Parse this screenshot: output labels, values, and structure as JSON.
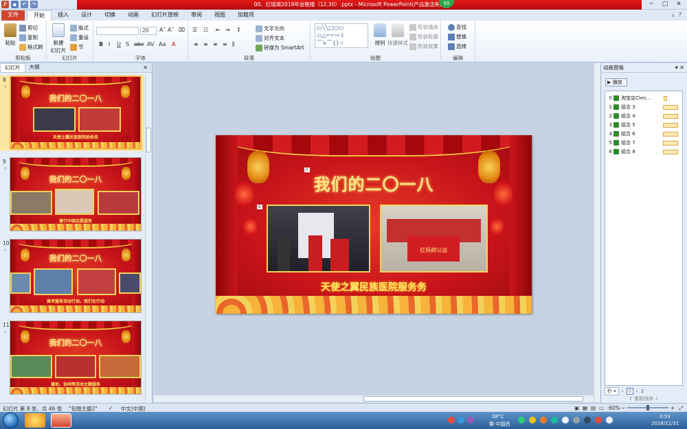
{
  "window": {
    "title": "00、红瑶瑛2019年会晚报（12.30）.pptx - Microsoft PowerPoint(产品激活失败)",
    "badge": "50"
  },
  "tabs": [
    "文件",
    "开始",
    "插入",
    "设计",
    "切换",
    "动画",
    "幻灯片放映",
    "审阅",
    "视图",
    "加载项"
  ],
  "ribbon": {
    "clipboard": {
      "paste": "粘贴",
      "cut": "剪切",
      "copy": "复制",
      "format_painter": "格式刷",
      "label": "剪贴板"
    },
    "slides": {
      "new_slide": "新建\n幻灯片",
      "layout": "版式",
      "reset": "重设",
      "section": "节",
      "label": "幻灯片"
    },
    "font": {
      "size": "20",
      "label": "字体"
    },
    "paragraph": {
      "text_direction": "文字方向",
      "align_text": "对齐文本",
      "smartart": "转换为 SmartArt",
      "label": "段落"
    },
    "drawing": {
      "arrange": "排列",
      "quick_styles": "快速样式",
      "shape_fill": "形状填充",
      "shape_outline": "形状轮廓",
      "shape_effects": "形状效果",
      "label": "绘图"
    },
    "editing": {
      "find": "查找",
      "replace": "替换",
      "select": "选择",
      "label": "编辑"
    }
  },
  "left_pane": {
    "tabs": [
      "幻灯片",
      "大纲"
    ],
    "slides": [
      {
        "num": "8",
        "title": "我们的二〇一八",
        "caption": "天使之翼民族医院助务务"
      },
      {
        "num": "9",
        "title": "我们的二〇一八",
        "caption": "善行中国志愿服务"
      },
      {
        "num": "10",
        "title": "我们的二〇一八",
        "caption": "高考服务活动行动，我们在行动"
      },
      {
        "num": "11",
        "title": "我们的二〇一八",
        "caption": "援助、协同等活动主题服务"
      }
    ]
  },
  "slide": {
    "title": "我们的二〇一八",
    "caption": "天使之翼民族医院服务务",
    "photo2_banner": "红杨柳公益",
    "tag1": "0",
    "tag2": "6"
  },
  "anim_pane": {
    "title": "动画窗格",
    "play": "播放",
    "items": [
      {
        "n": "0",
        "label": "淘宝店Clen..."
      },
      {
        "n": "1",
        "label": "组合 3"
      },
      {
        "n": "2",
        "label": "组合 4"
      },
      {
        "n": "3",
        "label": "组合 5"
      },
      {
        "n": "4",
        "label": "组合 6"
      },
      {
        "n": "5",
        "label": "组合 7"
      },
      {
        "n": "6",
        "label": "组合 8"
      }
    ],
    "seconds_label": "秒",
    "timeline_start": "0",
    "timeline_end": "2",
    "reorder": "重新排序"
  },
  "status": {
    "slide_info": "幻灯片 第 8 张，共 46 张",
    "theme": "\"包图主题2\"",
    "language": "中文(中国)",
    "zoom": "60%"
  },
  "taskbar": {
    "temp": "38°C",
    "weather": "雾-中国西",
    "time": "0:53",
    "date": "2018/12/31"
  },
  "colors": {
    "accent": "#d1442f",
    "title_red": "#c80f10",
    "slide_gold": "#fde58a"
  }
}
